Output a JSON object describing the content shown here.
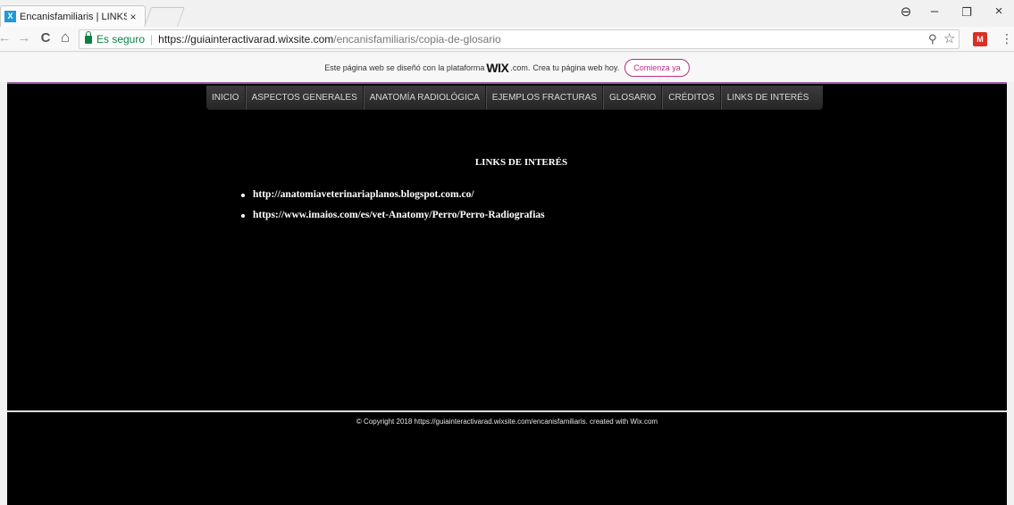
{
  "browser": {
    "tab_title": "Encanisfamiliaris | LINKS",
    "tab_close": "×",
    "favicon_letter": "X",
    "controls": {
      "account": "⊖",
      "minimize": "–",
      "restore": "❐",
      "close": "×"
    }
  },
  "toolbar": {
    "back": "←",
    "forward": "→",
    "reload": "C",
    "home": "⌂",
    "secure_label": "Es seguro",
    "url_separator": "|",
    "url_domain": "https://guiainteractivarad.wixsite.com",
    "url_path": "/encanisfamiliaris/copia-de-glosario",
    "zoom_icon": "⚲",
    "bookmark_icon": "☆",
    "extension_label": "M",
    "menu_icon": "⋮"
  },
  "wix_banner": {
    "text_before": "Este página web se diseñó con la plataforma",
    "logo": "WIX",
    "logo_suffix": ".com.",
    "text_after": "Crea tu página web hoy.",
    "button_label": "Comienza ya"
  },
  "site_nav": {
    "items": [
      "INICIO",
      "ASPECTOS GENERALES",
      "ANATOMÍA RADIOLÓGICA",
      "EJEMPLOS FRACTURAS",
      "GLOSARIO",
      "CRÉDITOS",
      "LINKS DE INTERÉS"
    ]
  },
  "content": {
    "title": "LINKS DE INTERÉS",
    "links": [
      "http://anatomiaveterinariaplanos.blogspot.com.co/",
      "https://www.imaios.com/es/vet-Anatomy/Perro/Perro-Radiografias"
    ]
  },
  "footer": {
    "copyright": "© Copyright 2018 https://guiainteractivarad.wixsite.com/encanisfamiliaris. created with Wix.com"
  }
}
